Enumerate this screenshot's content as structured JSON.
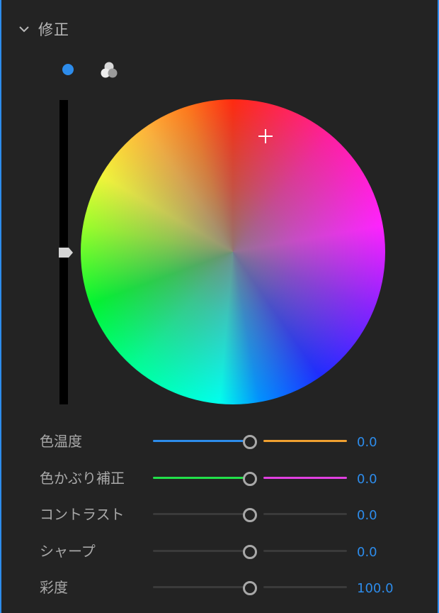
{
  "section": {
    "title": "修正"
  },
  "mode": {
    "single_icon": "blue-dot-icon",
    "rgb_icon": "rgb-circles-icon"
  },
  "wheel": {
    "luminance_level": 0.5,
    "accent_color": "#2d8ceb"
  },
  "sliders": [
    {
      "label": "色温度",
      "value": "0.0",
      "position": 0.5,
      "left_color": "#2d8ceb",
      "right_color": "#f0a030"
    },
    {
      "label": "色かぶり補正",
      "value": "0.0",
      "position": 0.5,
      "left_color": "#22e04a",
      "right_color": "#e040e0"
    },
    {
      "label": "コントラスト",
      "value": "0.0",
      "position": 0.5,
      "left_color": "#3a3a3a",
      "right_color": "#3a3a3a"
    },
    {
      "label": "シャープ",
      "value": "0.0",
      "position": 0.5,
      "left_color": "#3a3a3a",
      "right_color": "#3a3a3a"
    },
    {
      "label": "彩度",
      "value": "100.0",
      "position": 0.5,
      "left_color": "#3a3a3a",
      "right_color": "#3a3a3a"
    }
  ]
}
